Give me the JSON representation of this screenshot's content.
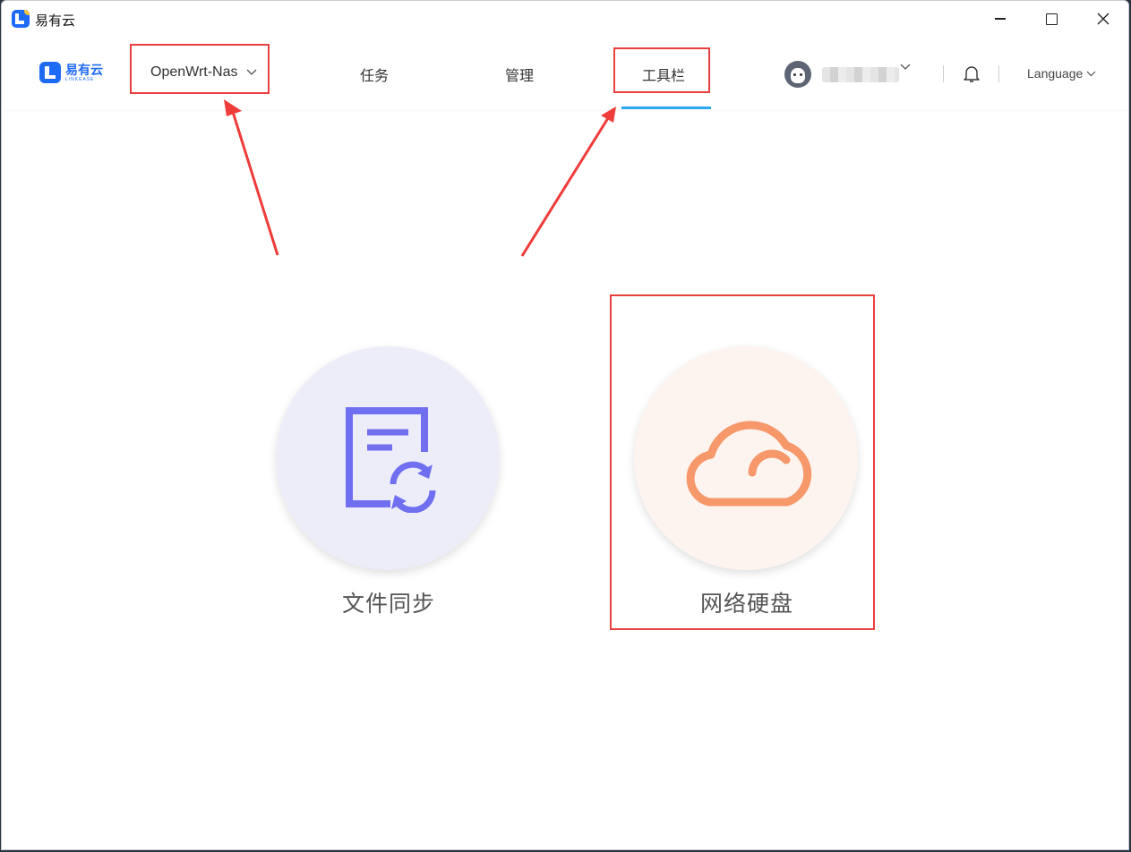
{
  "window": {
    "title": "易有云",
    "controls": [
      "minimize",
      "maximize",
      "close"
    ]
  },
  "nav": {
    "brand_name": "易有云",
    "brand_sub": "LINKEASE",
    "device_select": "OpenWrt-Nas",
    "tabs": [
      {
        "label": "任务"
      },
      {
        "label": "管理"
      },
      {
        "label": "工具栏",
        "active": true
      }
    ],
    "language_label": "Language"
  },
  "tools": [
    {
      "label": "文件同步",
      "icon": "file-sync-icon",
      "color": "#6f6ff0"
    },
    {
      "label": "网络硬盘",
      "icon": "cloud-icon",
      "color": "#f6986a"
    }
  ],
  "colors": {
    "brand": "#1f6af5",
    "active_tab_underline": "#2aa7f2",
    "annotation": "#e8403e"
  }
}
